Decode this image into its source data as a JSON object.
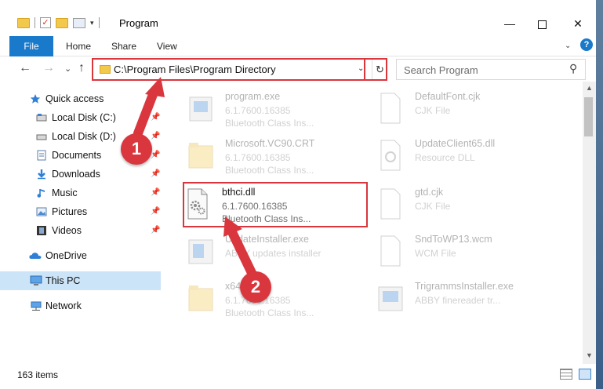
{
  "window": {
    "title": "Program",
    "qa_check_glyph": "✓",
    "qa_dropdown_glyph": "▾",
    "minimize_glyph": "—",
    "close_glyph": "✕"
  },
  "ribbon": {
    "file": "File",
    "home": "Home",
    "share": "Share",
    "view": "View",
    "expand_glyph": "⌄",
    "help_glyph": "?"
  },
  "nav": {
    "back_glyph": "←",
    "forward_glyph": "→",
    "recent_glyph": "⌄",
    "up_glyph": "↑",
    "address": "C:\\Program Files\\Program Directory",
    "address_dropdown_glyph": "⌄",
    "refresh_glyph": "↻",
    "search_placeholder": "Search Program",
    "search_glyph": "⚲"
  },
  "sidebar": {
    "pin_glyph": "📌",
    "items": [
      {
        "label": "Quick access"
      },
      {
        "label": "Local Disk (C:)"
      },
      {
        "label": "Local Disk (D:)"
      },
      {
        "label": "Documents"
      },
      {
        "label": "Downloads"
      },
      {
        "label": "Music"
      },
      {
        "label": "Pictures"
      },
      {
        "label": "Videos"
      },
      {
        "label": "OneDrive"
      },
      {
        "label": "This PC"
      },
      {
        "label": "Network"
      }
    ]
  },
  "files": [
    {
      "name": "program.exe",
      "line1": "6.1.7600.16385",
      "line2": "Bluetooth Class Ins..."
    },
    {
      "name": "DefaultFont.cjk",
      "line1": "CJK File",
      "line2": ""
    },
    {
      "name": "Microsoft.VC90.CRT",
      "line1": "6.1.7600.16385",
      "line2": "Bluetooth Class Ins..."
    },
    {
      "name": "UpdateClient65.dll",
      "line1": "Resource DLL",
      "line2": ""
    },
    {
      "name": "bthci.dll",
      "line1": "6.1.7600.16385",
      "line2": "Bluetooth Class Ins..."
    },
    {
      "name": "gtd.cjk",
      "line1": "CJK File",
      "line2": ""
    },
    {
      "name": "UpdateInstaller.exe",
      "line1": "ABBY updates installer",
      "line2": ""
    },
    {
      "name": "SndToWP13.wcm",
      "line1": "WCM File",
      "line2": ""
    },
    {
      "name": "x64",
      "line1": "6.1.7600.16385",
      "line2": "Bluetooth Class Ins..."
    },
    {
      "name": "TrigrammsInstaller.exe",
      "line1": "ABBY finereader tr...",
      "line2": ""
    }
  ],
  "scroll": {
    "up_glyph": "▲",
    "down_glyph": "▼"
  },
  "status": {
    "items": "163 items"
  },
  "markers": {
    "one": "1",
    "two": "2"
  },
  "colors": {
    "accent": "#1979ca",
    "highlight": "#d9363e",
    "selected": "#cce4f7"
  }
}
